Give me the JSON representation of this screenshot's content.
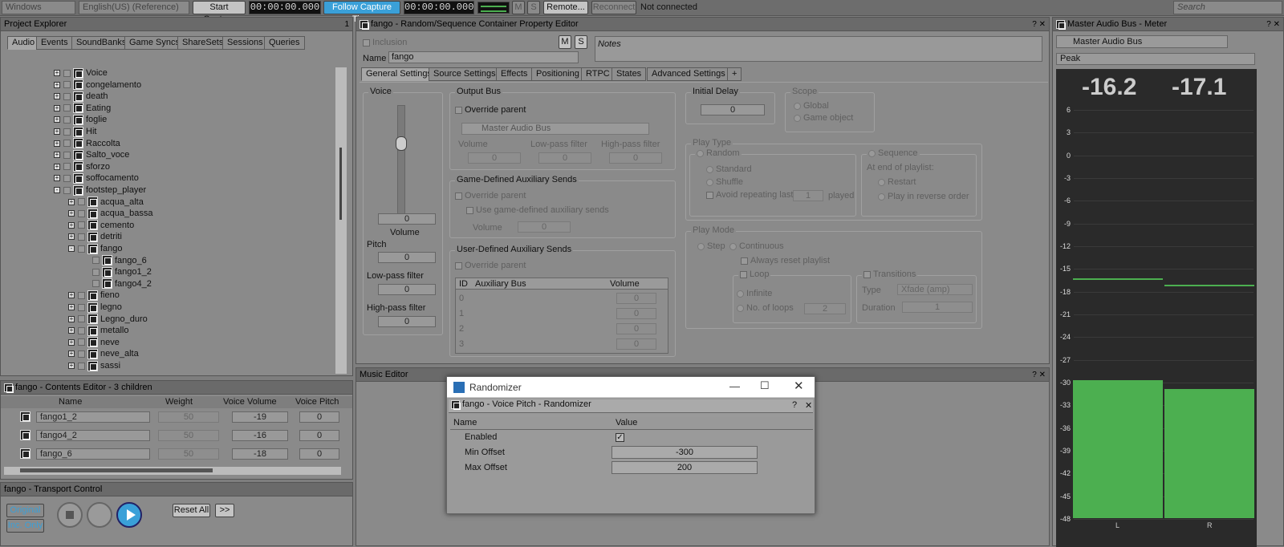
{
  "toolbar": {
    "layout": "Windows",
    "language": "English(US) (Reference)",
    "start_capture": "Start Capture",
    "time1": "00:00:00.000",
    "follow_capture": "Follow Capture Time",
    "time2": "00:00:00.000",
    "m": "M",
    "s": "S",
    "remote": "Remote...",
    "reconnect": "Reconnect",
    "status": "Not connected",
    "search_placeholder": "Search"
  },
  "explorer": {
    "title": "Project Explorer",
    "num": "1",
    "tabs": [
      "Audio",
      "Events",
      "SoundBanks",
      "Game Syncs",
      "ShareSets",
      "Sessions",
      "Queries"
    ],
    "items": [
      "Voice",
      "congelamento",
      "death",
      "Eating",
      "foglie",
      "Hit",
      "Raccolta",
      "Salto_voce",
      "sforzo",
      "soffocamento",
      "footstep_player"
    ],
    "children": [
      "acqua_alta",
      "acqua_bassa",
      "cemento",
      "detriti",
      "fango"
    ],
    "grandchildren": [
      "fango_6",
      "fango1_2",
      "fango4_2"
    ],
    "after": [
      "fieno",
      "legno",
      "Legno_duro",
      "metallo",
      "neve",
      "neve_alta",
      "sassi"
    ]
  },
  "contents": {
    "title": "fango - Contents Editor - 3 children",
    "cols": [
      "Name",
      "Weight",
      "Voice Volume",
      "Voice Pitch"
    ],
    "rows": [
      {
        "name": "fango1_2",
        "weight": "50",
        "vol": "-19",
        "pitch": "0"
      },
      {
        "name": "fango4_2",
        "weight": "50",
        "vol": "-16",
        "pitch": "0"
      },
      {
        "name": "fango_6",
        "weight": "50",
        "vol": "-18",
        "pitch": "0"
      }
    ]
  },
  "transport": {
    "title": "fango - Transport Control",
    "original": "Original",
    "inc_only": "Inc. Only",
    "reset": "Reset All",
    "more": ">>"
  },
  "editor": {
    "title": "fango - Random/Sequence Container Property Editor",
    "inclusion": "Inclusion",
    "m": "M",
    "s": "S",
    "name_label": "Name",
    "name_value": "fango",
    "notes": "Notes",
    "tabs": [
      "General Settings",
      "Source Settings",
      "Effects",
      "Positioning",
      "RTPC",
      "States",
      "Advanced Settings",
      "+"
    ],
    "voice": "Voice",
    "volume_val": "0",
    "volume": "Volume",
    "pitch": "Pitch",
    "pitch_val": "0",
    "lpf": "Low-pass filter",
    "lpf_val": "0",
    "hpf": "High-pass filter",
    "hpf_val": "0",
    "output_bus": "Output Bus",
    "override_parent": "Override parent",
    "master_bus": "Master Audio Bus",
    "ob_volume": "Volume",
    "ob_lpf": "Low-pass filter",
    "ob_hpf": "High-pass filter",
    "zero": "0",
    "gdas": "Game-Defined Auxiliary Sends",
    "use_gdas": "Use game-defined auxiliary sends",
    "udas": "User-Defined Auxiliary Sends",
    "aux_cols": [
      "ID",
      "Auxiliary Bus",
      "Volume"
    ],
    "aux_ids": [
      "0",
      "1",
      "2",
      "3"
    ],
    "initial_delay": "Initial Delay",
    "scope": "Scope",
    "global": "Global",
    "game_object": "Game object",
    "play_type": "Play Type",
    "random": "Random",
    "standard": "Standard",
    "shuffle": "Shuffle",
    "avoid": "Avoid repeating last",
    "avoid_val": "1",
    "played": "played",
    "sequence": "Sequence",
    "end_playlist": "At end of playlist:",
    "restart": "Restart",
    "reverse": "Play in reverse order",
    "play_mode": "Play Mode",
    "step": "Step",
    "continuous": "Continuous",
    "always_reset": "Always reset playlist",
    "loop": "Loop",
    "infinite": "Infinite",
    "no_loops": "No. of loops",
    "loops_val": "2",
    "transitions": "Transitions",
    "type": "Type",
    "type_val": "Xfade (amp)",
    "duration": "Duration",
    "duration_val": "1"
  },
  "music": {
    "title": "Music Editor"
  },
  "meter": {
    "title": "Master Audio Bus - Meter",
    "bus": "Master Audio Bus",
    "mode": "Peak",
    "left_db": "-16.2",
    "right_db": "-17.1",
    "left_label": "L",
    "right_label": "R",
    "scale": [
      "6",
      "3",
      "0",
      "-3",
      "-6",
      "-9",
      "-12",
      "-15",
      "-18",
      "-21",
      "-24",
      "-27",
      "-30",
      "-33",
      "-36",
      "-39",
      "-42",
      "-45",
      "-48"
    ],
    "left_level": 0.33,
    "right_level": 0.31,
    "left_peak_db": -16.2,
    "right_peak_db": -17.1
  },
  "randomizer": {
    "window_title": "Randomizer",
    "inner_title": "fango - Voice Pitch - Randomizer",
    "col_name": "Name",
    "col_value": "Value",
    "enabled": "Enabled",
    "min": "Min Offset",
    "min_val": "-300",
    "max": "Max Offset",
    "max_val": "200"
  }
}
